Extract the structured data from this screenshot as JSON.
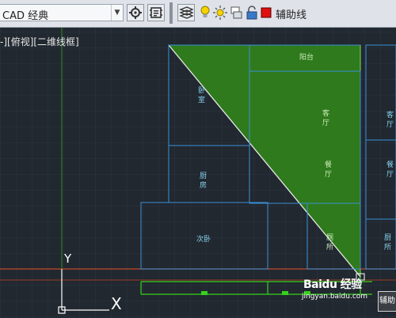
{
  "toolbar": {
    "workspace": "CAD 经典",
    "layer": "辅助线",
    "layer_color": "#e01010"
  },
  "viewport": {
    "label": "-][俯视][二维线框]"
  },
  "rooms": {
    "balcony": "阳台",
    "bedroom": "卧\n室",
    "kitchen": "厨\n房",
    "second_bedroom": "次卧",
    "living_room_1": "客\n厅",
    "living_room_2": "餐\n厅",
    "bath": "厕\n所",
    "right_1": "客\n厅",
    "right_2": "餐\n厅",
    "right_3": "厨\n所"
  },
  "ucs": {
    "y": "Y",
    "x": "X"
  },
  "watermark": {
    "logo": "Baidu 经验",
    "url": "jingyan.baidu.com",
    "corner": "辅助"
  },
  "colors": {
    "background": "#212830",
    "wall_lines": "#3b8fd6",
    "fill": "#2f7a1c",
    "axis_line": "#c44a2a",
    "aux_line": "#36d11d"
  },
  "icons": [
    "settings-icon",
    "gear-icon",
    "match-properties-icon",
    "bulb-icon",
    "sun-icon",
    "layer-icon",
    "lock-icon",
    "color-swatch-icon"
  ]
}
